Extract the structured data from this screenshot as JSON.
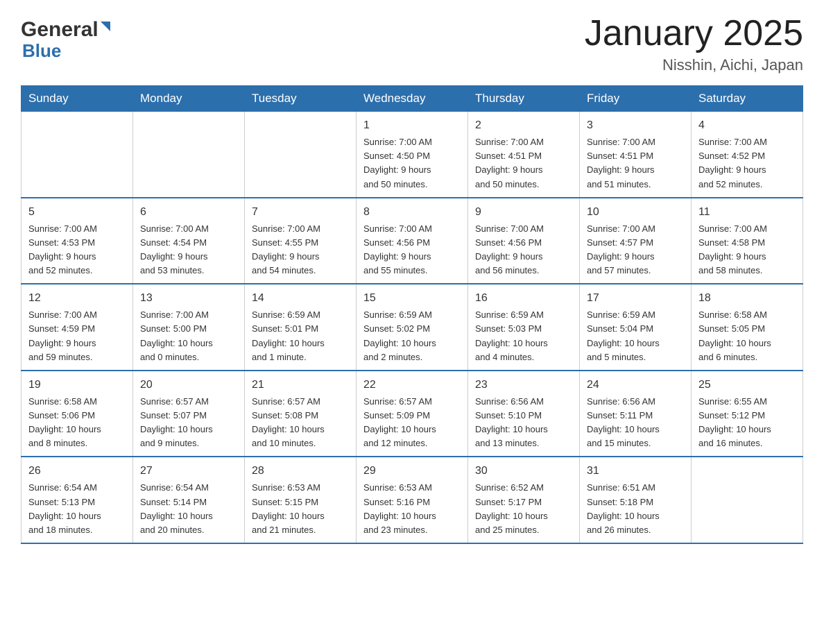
{
  "header": {
    "logo_general": "General",
    "logo_blue": "Blue",
    "title": "January 2025",
    "subtitle": "Nisshin, Aichi, Japan"
  },
  "days_of_week": [
    "Sunday",
    "Monday",
    "Tuesday",
    "Wednesday",
    "Thursday",
    "Friday",
    "Saturday"
  ],
  "weeks": [
    [
      {
        "day": "",
        "info": ""
      },
      {
        "day": "",
        "info": ""
      },
      {
        "day": "",
        "info": ""
      },
      {
        "day": "1",
        "info": "Sunrise: 7:00 AM\nSunset: 4:50 PM\nDaylight: 9 hours\nand 50 minutes."
      },
      {
        "day": "2",
        "info": "Sunrise: 7:00 AM\nSunset: 4:51 PM\nDaylight: 9 hours\nand 50 minutes."
      },
      {
        "day": "3",
        "info": "Sunrise: 7:00 AM\nSunset: 4:51 PM\nDaylight: 9 hours\nand 51 minutes."
      },
      {
        "day": "4",
        "info": "Sunrise: 7:00 AM\nSunset: 4:52 PM\nDaylight: 9 hours\nand 52 minutes."
      }
    ],
    [
      {
        "day": "5",
        "info": "Sunrise: 7:00 AM\nSunset: 4:53 PM\nDaylight: 9 hours\nand 52 minutes."
      },
      {
        "day": "6",
        "info": "Sunrise: 7:00 AM\nSunset: 4:54 PM\nDaylight: 9 hours\nand 53 minutes."
      },
      {
        "day": "7",
        "info": "Sunrise: 7:00 AM\nSunset: 4:55 PM\nDaylight: 9 hours\nand 54 minutes."
      },
      {
        "day": "8",
        "info": "Sunrise: 7:00 AM\nSunset: 4:56 PM\nDaylight: 9 hours\nand 55 minutes."
      },
      {
        "day": "9",
        "info": "Sunrise: 7:00 AM\nSunset: 4:56 PM\nDaylight: 9 hours\nand 56 minutes."
      },
      {
        "day": "10",
        "info": "Sunrise: 7:00 AM\nSunset: 4:57 PM\nDaylight: 9 hours\nand 57 minutes."
      },
      {
        "day": "11",
        "info": "Sunrise: 7:00 AM\nSunset: 4:58 PM\nDaylight: 9 hours\nand 58 minutes."
      }
    ],
    [
      {
        "day": "12",
        "info": "Sunrise: 7:00 AM\nSunset: 4:59 PM\nDaylight: 9 hours\nand 59 minutes."
      },
      {
        "day": "13",
        "info": "Sunrise: 7:00 AM\nSunset: 5:00 PM\nDaylight: 10 hours\nand 0 minutes."
      },
      {
        "day": "14",
        "info": "Sunrise: 6:59 AM\nSunset: 5:01 PM\nDaylight: 10 hours\nand 1 minute."
      },
      {
        "day": "15",
        "info": "Sunrise: 6:59 AM\nSunset: 5:02 PM\nDaylight: 10 hours\nand 2 minutes."
      },
      {
        "day": "16",
        "info": "Sunrise: 6:59 AM\nSunset: 5:03 PM\nDaylight: 10 hours\nand 4 minutes."
      },
      {
        "day": "17",
        "info": "Sunrise: 6:59 AM\nSunset: 5:04 PM\nDaylight: 10 hours\nand 5 minutes."
      },
      {
        "day": "18",
        "info": "Sunrise: 6:58 AM\nSunset: 5:05 PM\nDaylight: 10 hours\nand 6 minutes."
      }
    ],
    [
      {
        "day": "19",
        "info": "Sunrise: 6:58 AM\nSunset: 5:06 PM\nDaylight: 10 hours\nand 8 minutes."
      },
      {
        "day": "20",
        "info": "Sunrise: 6:57 AM\nSunset: 5:07 PM\nDaylight: 10 hours\nand 9 minutes."
      },
      {
        "day": "21",
        "info": "Sunrise: 6:57 AM\nSunset: 5:08 PM\nDaylight: 10 hours\nand 10 minutes."
      },
      {
        "day": "22",
        "info": "Sunrise: 6:57 AM\nSunset: 5:09 PM\nDaylight: 10 hours\nand 12 minutes."
      },
      {
        "day": "23",
        "info": "Sunrise: 6:56 AM\nSunset: 5:10 PM\nDaylight: 10 hours\nand 13 minutes."
      },
      {
        "day": "24",
        "info": "Sunrise: 6:56 AM\nSunset: 5:11 PM\nDaylight: 10 hours\nand 15 minutes."
      },
      {
        "day": "25",
        "info": "Sunrise: 6:55 AM\nSunset: 5:12 PM\nDaylight: 10 hours\nand 16 minutes."
      }
    ],
    [
      {
        "day": "26",
        "info": "Sunrise: 6:54 AM\nSunset: 5:13 PM\nDaylight: 10 hours\nand 18 minutes."
      },
      {
        "day": "27",
        "info": "Sunrise: 6:54 AM\nSunset: 5:14 PM\nDaylight: 10 hours\nand 20 minutes."
      },
      {
        "day": "28",
        "info": "Sunrise: 6:53 AM\nSunset: 5:15 PM\nDaylight: 10 hours\nand 21 minutes."
      },
      {
        "day": "29",
        "info": "Sunrise: 6:53 AM\nSunset: 5:16 PM\nDaylight: 10 hours\nand 23 minutes."
      },
      {
        "day": "30",
        "info": "Sunrise: 6:52 AM\nSunset: 5:17 PM\nDaylight: 10 hours\nand 25 minutes."
      },
      {
        "day": "31",
        "info": "Sunrise: 6:51 AM\nSunset: 5:18 PM\nDaylight: 10 hours\nand 26 minutes."
      },
      {
        "day": "",
        "info": ""
      }
    ]
  ]
}
